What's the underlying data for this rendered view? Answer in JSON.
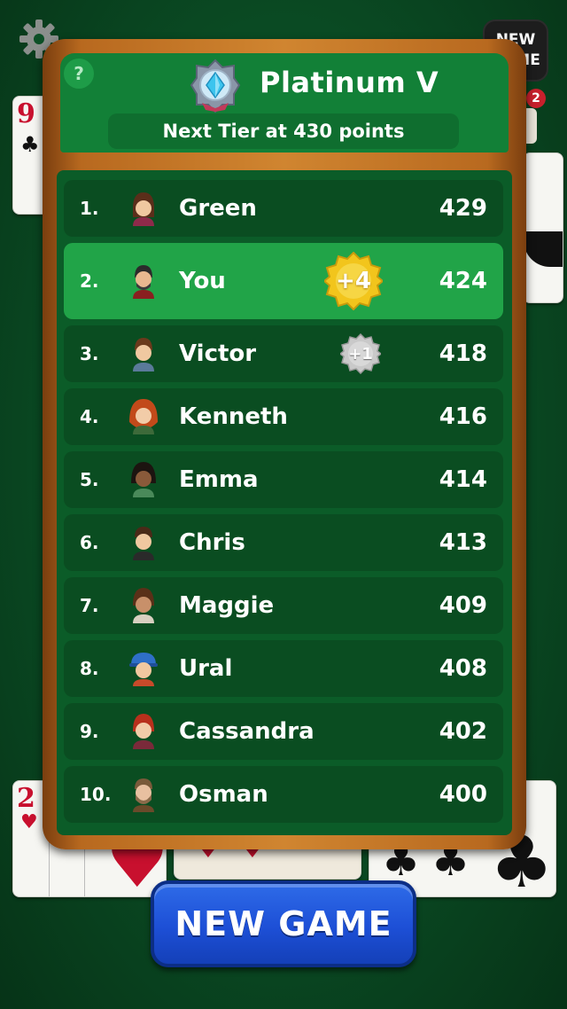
{
  "top_bar": {
    "new_game_line1": "NEW",
    "new_game_line2": "GAME",
    "notification_count": "2"
  },
  "cards": {
    "top_left_rank": "9",
    "bottom_left_rank": "2"
  },
  "leaderboard": {
    "help_label": "?",
    "tier_icon": "platinum-crest-icon",
    "tier_title": "Platinum V",
    "next_tier_text": "Next Tier at 430 points",
    "rows": [
      {
        "rank": "1.",
        "name": "Green",
        "score": "429"
      },
      {
        "rank": "2.",
        "name": "You",
        "score": "424",
        "bonus": "+4"
      },
      {
        "rank": "3.",
        "name": "Victor",
        "score": "418",
        "bonus": "+1"
      },
      {
        "rank": "4.",
        "name": "Kenneth",
        "score": "416"
      },
      {
        "rank": "5.",
        "name": "Emma",
        "score": "414"
      },
      {
        "rank": "6.",
        "name": "Chris",
        "score": "413"
      },
      {
        "rank": "7.",
        "name": "Maggie",
        "score": "409"
      },
      {
        "rank": "8.",
        "name": "Ural",
        "score": "408"
      },
      {
        "rank": "9.",
        "name": "Cassandra",
        "score": "402"
      },
      {
        "rank": "10.",
        "name": "Osman",
        "score": "400"
      }
    ]
  },
  "new_game_button": "NEW GAME",
  "colors": {
    "felt": "#0a4a23",
    "highlight_row": "#21a448",
    "button_blue": "#1d4fd6",
    "gold_badge": "#f2c51c",
    "silver_badge": "#c9c9c9"
  }
}
